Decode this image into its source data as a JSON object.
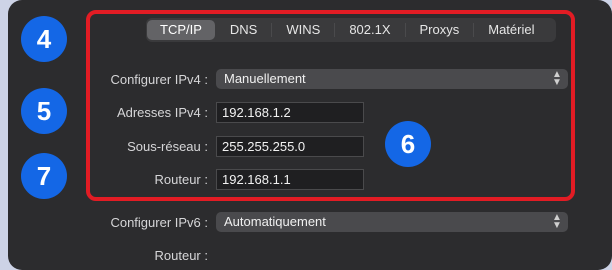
{
  "tabs": [
    {
      "label": "TCP/IP",
      "active": true
    },
    {
      "label": "DNS",
      "active": false
    },
    {
      "label": "WINS",
      "active": false
    },
    {
      "label": "802.1X",
      "active": false
    },
    {
      "label": "Proxys",
      "active": false
    },
    {
      "label": "Matériel",
      "active": false
    }
  ],
  "ipv4": {
    "configure_label": "Configurer IPv4 :",
    "configure_value": "Manuellement",
    "address_label": "Adresses IPv4 :",
    "address_value": "192.168.1.2",
    "subnet_label": "Sous-réseau :",
    "subnet_value": "255.255.255.0",
    "router_label": "Routeur :",
    "router_value": "192.168.1.1"
  },
  "ipv6": {
    "configure_label": "Configurer IPv6 :",
    "configure_value": "Automatiquement",
    "router_label": "Routeur :"
  },
  "badges": [
    "4",
    "5",
    "6",
    "7"
  ],
  "colors": {
    "annotation_badge": "#1467e6",
    "highlight_box": "#e21c24",
    "panel_background": "#2c2c2e",
    "page_background": "#cdd3e6"
  },
  "icons": {
    "select_arrow": "chevron-up-down-icon"
  }
}
